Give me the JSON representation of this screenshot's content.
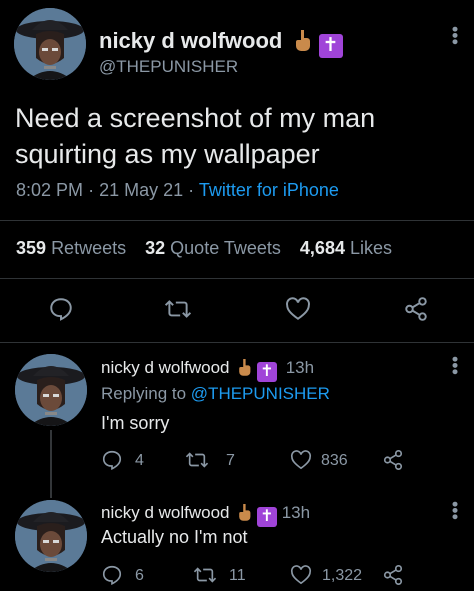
{
  "main_tweet": {
    "display_name": "nicky d wolfwood",
    "handle": "@THEPUNISHER",
    "text_line1": "Need a screenshot of my man",
    "text_line2": "squirting as my wallpaper",
    "time": "8:02 PM",
    "date": "21 May 21",
    "source": "Twitter for iPhone",
    "retweets_count": "359",
    "retweets_label": "Retweets",
    "quotes_count": "32",
    "quotes_label": "Quote Tweets",
    "likes_count": "4,684",
    "likes_label": "Likes"
  },
  "replies": [
    {
      "display_name": "nicky d wolfwood",
      "time": "13h",
      "replying_prefix": "Replying to",
      "replying_to": "@THEPUNISHER",
      "text": "I'm sorry",
      "reply_count": "4",
      "retweet_count": "7",
      "like_count": "836"
    },
    {
      "display_name": "nicky d wolfwood",
      "time": "13h",
      "text": "Actually no I'm not",
      "reply_count": "6",
      "retweet_count": "11",
      "like_count": "1,322"
    }
  ],
  "colors": {
    "background": "#000000",
    "text": "#e7e9ea",
    "secondary": "#8b98a5",
    "link": "#1d9bf0",
    "emoji_cross_bg": "#a044d8"
  },
  "icons": [
    "more-icon",
    "reply-icon",
    "retweet-icon",
    "like-icon",
    "share-icon",
    "hand-emoji-icon",
    "latin-cross-emoji-icon"
  ]
}
